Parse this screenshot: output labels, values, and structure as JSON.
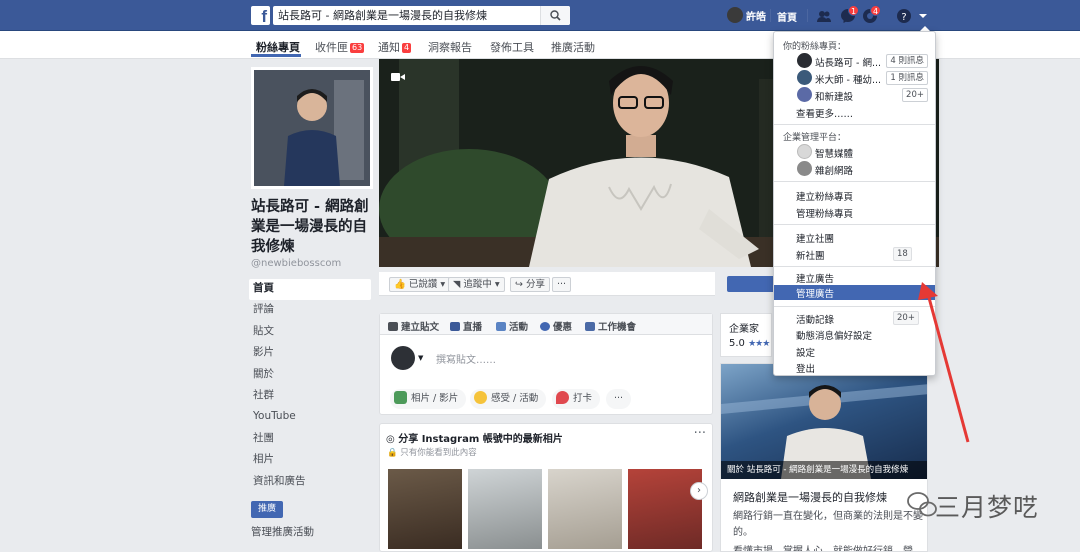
{
  "topbar": {
    "search_value": "站長路可 - 網路創業是一場漫長的自我修煉",
    "user_name": "許皓",
    "home_label": "首頁",
    "messages_badge": "1",
    "notifications_badge": "4",
    "icons": [
      "facebook-logo",
      "search-icon",
      "friends-icon",
      "messenger-icon",
      "notifications-icon",
      "help-icon",
      "caret-down-icon"
    ]
  },
  "tabs": [
    {
      "label": "粉絲專頁",
      "active": true
    },
    {
      "label": "收件匣",
      "badge": "63"
    },
    {
      "label": "通知",
      "badge": "4"
    },
    {
      "label": "洞察報告"
    },
    {
      "label": "發佈工具"
    },
    {
      "label": "推廣活動"
    }
  ],
  "page": {
    "name": "站長路可 - 網路創業是一場漫長的自我修煉",
    "handle": "@newbiebosscom"
  },
  "left_nav": [
    "首頁",
    "評論",
    "貼文",
    "影片",
    "關於",
    "社群",
    "YouTube",
    "社團",
    "相片",
    "資訊和廣告"
  ],
  "promote_button": "推廣",
  "manage_promotions": "管理推廣活動",
  "actions": {
    "liked": "已說讚",
    "following": "追蹤中",
    "share": "分享",
    "more": "···"
  },
  "composer": {
    "tabs": [
      "建立貼文",
      "直播",
      "活動",
      "優惠",
      "工作機會"
    ],
    "placeholder": "撰寫貼文……",
    "options": [
      "相片 / 影片",
      "感受 / 活動",
      "打卡"
    ],
    "more": "···"
  },
  "instagram": {
    "title": "分享 Instagram 帳號中的最新相片",
    "subtitle": "只有你能看到此內容",
    "more": "···"
  },
  "right": {
    "category": "企業家",
    "rating": "5.0",
    "promo_caption": "關於 站長路可 - 網路創業是一場漫長的自我修煉",
    "promo_title": "網路創業是一場漫長的自我修煉",
    "promo_desc": "網路行銷一直在變化，但商業的法則是不變的。",
    "promo_desc2": "看懂市場，掌握人心，就能做好行銷。營"
  },
  "dropdown": {
    "your_pages_header": "你的粉絲專頁：",
    "pages": [
      {
        "name": "站長路可 - 網...",
        "count": "4 則訊息"
      },
      {
        "name": "米大師 - 種幼...",
        "count": "1 則訊息"
      },
      {
        "name": "和新建設",
        "count": "20+"
      }
    ],
    "see_more": "查看更多……",
    "business_header": "企業管理平台：",
    "business": [
      "智慧媒體",
      "雜創網路"
    ],
    "create_page": "建立粉絲專頁",
    "manage_pages": "管理粉絲專頁",
    "create_group": "建立社團",
    "new_groups": "新社團",
    "new_groups_count": "18",
    "create_ads": "建立廣告",
    "manage_ads": "管理廣告",
    "activity_log": "活動記錄",
    "activity_count": "20+",
    "news_feed_prefs": "動態消息偏好設定",
    "settings": "設定",
    "logout": "登出"
  },
  "watermark": "三月梦呓",
  "colors": {
    "brand": "#3b5998",
    "accent": "#4267b2",
    "badge": "#fa3e3e",
    "arrow": "#e53935"
  }
}
